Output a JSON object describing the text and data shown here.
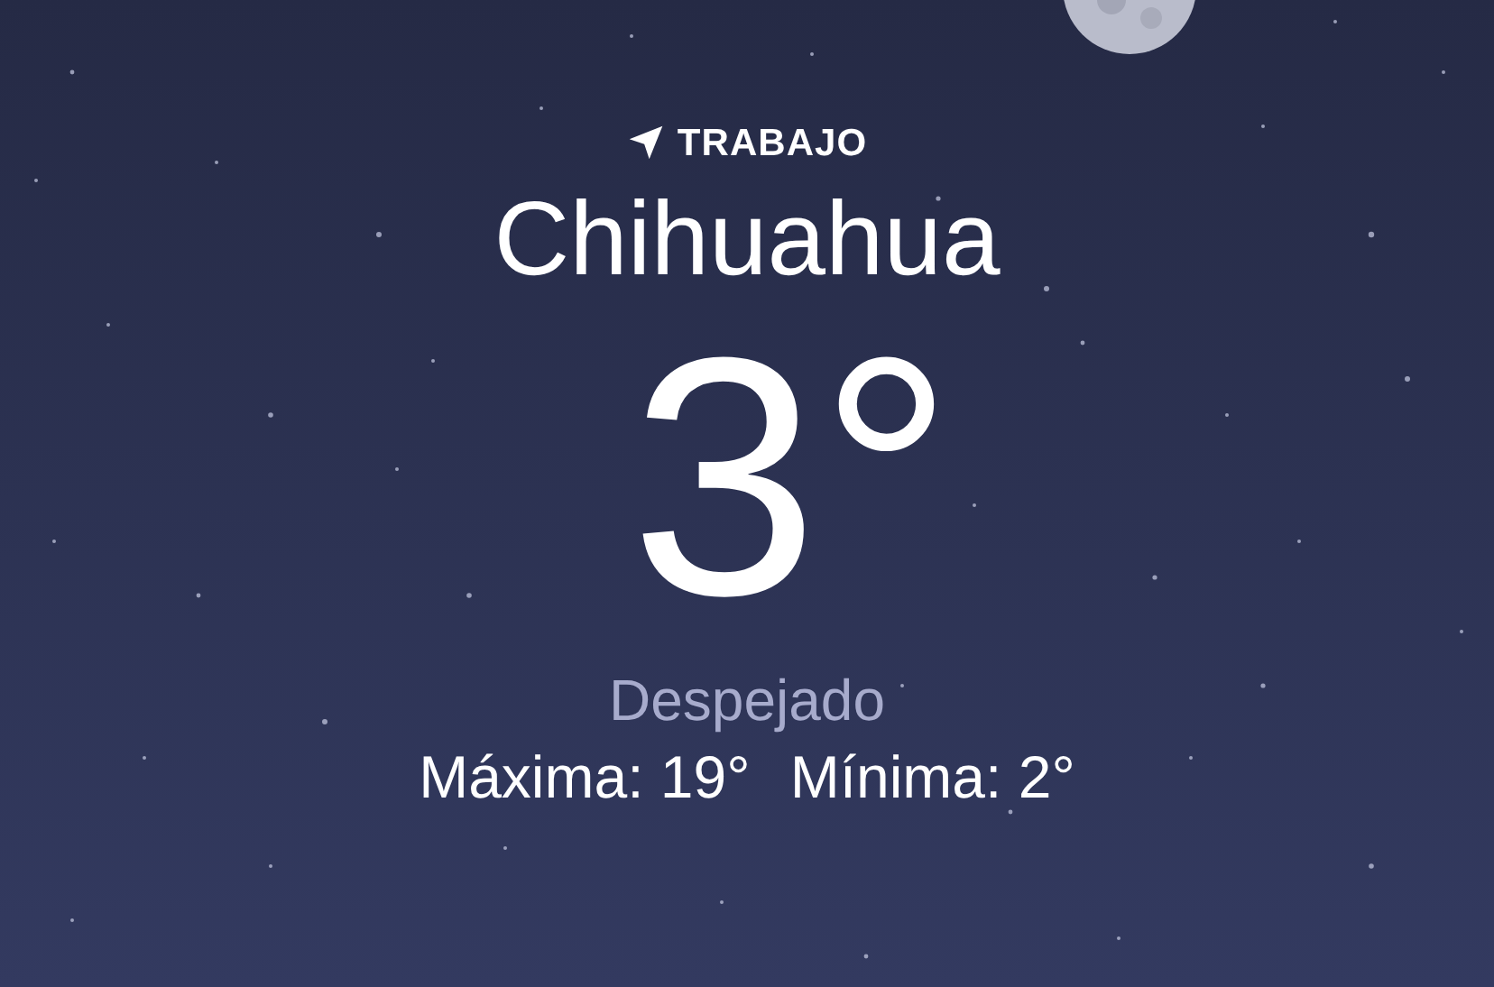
{
  "location": {
    "label": "TRABAJO"
  },
  "city": "Chihuahua",
  "temperature": "3°",
  "condition": "Despejado",
  "high": "Máxima: 19°",
  "low": "Mínima: 2°"
}
